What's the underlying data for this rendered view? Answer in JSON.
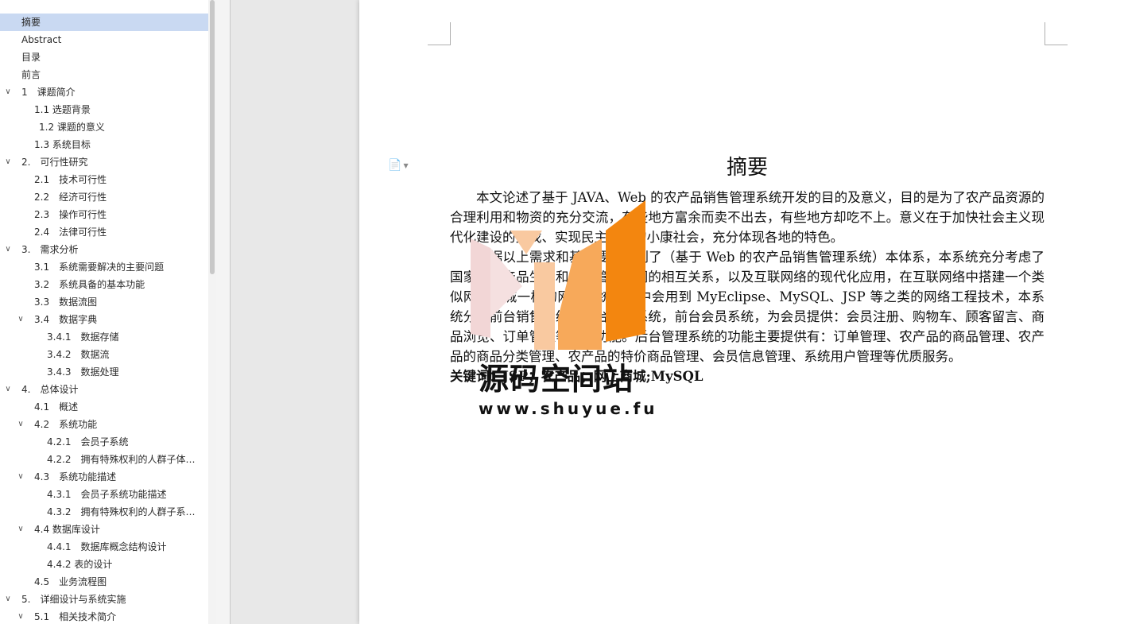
{
  "nav": {
    "items": [
      {
        "label": "摘要",
        "level": 0,
        "expandable": false,
        "selected": true
      },
      {
        "label": "Abstract",
        "level": 0,
        "expandable": false
      },
      {
        "label": "目录",
        "level": 0,
        "expandable": false
      },
      {
        "label": "前言",
        "level": 0,
        "expandable": false
      },
      {
        "label": "1　课题简介",
        "level": 0,
        "expandable": true
      },
      {
        "label": "1.1  选题背景",
        "level": 1,
        "expandable": false
      },
      {
        "label": "1.2  课题的意义",
        "level": 1,
        "expandable": false,
        "extra_indent": true
      },
      {
        "label": "1.3  系统目标",
        "level": 1,
        "expandable": false
      },
      {
        "label": "2.　可行性研究",
        "level": 0,
        "expandable": true
      },
      {
        "label": "2.1　技术可行性",
        "level": 1,
        "expandable": false
      },
      {
        "label": "2.2　经济可行性",
        "level": 1,
        "expandable": false
      },
      {
        "label": "2.3　操作可行性",
        "level": 1,
        "expandable": false
      },
      {
        "label": "2.4　法律可行性",
        "level": 1,
        "expandable": false
      },
      {
        "label": "3.　需求分析",
        "level": 0,
        "expandable": true
      },
      {
        "label": "3.1　系统需要解决的主要问题",
        "level": 1,
        "expandable": false
      },
      {
        "label": "3.2　系统具备的基本功能",
        "level": 1,
        "expandable": false
      },
      {
        "label": "3.3　数据流图",
        "level": 1,
        "expandable": false
      },
      {
        "label": "3.4　数据字典",
        "level": 1,
        "expandable": true
      },
      {
        "label": "3.4.1　数据存储",
        "level": 2,
        "expandable": false
      },
      {
        "label": "3.4.2　数据流",
        "level": 2,
        "expandable": false
      },
      {
        "label": "3.4.3　数据处理",
        "level": 2,
        "expandable": false
      },
      {
        "label": "4.　总体设计",
        "level": 0,
        "expandable": true
      },
      {
        "label": "4.1　概述",
        "level": 1,
        "expandable": false
      },
      {
        "label": "4.2　系统功能",
        "level": 1,
        "expandable": true
      },
      {
        "label": "4.2.1　会员子系统",
        "level": 2,
        "expandable": false
      },
      {
        "label": "4.2.2　拥有特殊权利的人群子体系 ...",
        "level": 2,
        "expandable": false
      },
      {
        "label": "4.3　系统功能描述",
        "level": 1,
        "expandable": true
      },
      {
        "label": "4.3.1　会员子系统功能描述",
        "level": 2,
        "expandable": false
      },
      {
        "label": "4.3.2　拥有特殊权利的人群子系统 ...",
        "level": 2,
        "expandable": false
      },
      {
        "label": "4.4  数据库设计",
        "level": 1,
        "expandable": true
      },
      {
        "label": "4.4.1　数据库概念结构设计",
        "level": 2,
        "expandable": false
      },
      {
        "label": "4.4.2 表的设计",
        "level": 2,
        "expandable": false
      },
      {
        "label": "4.5　业务流程图",
        "level": 1,
        "expandable": false
      },
      {
        "label": "5.　详细设计与系统实施",
        "level": 0,
        "expandable": true
      },
      {
        "label": "5.1　相关技术简介",
        "level": 1,
        "expandable": true
      }
    ]
  },
  "document": {
    "title": "摘要",
    "paragraphs": [
      "本文论述了基于 JAVA、Web 的农产品销售管理系统开发的目的及意义，目的是为了农产品资源的合理利用和物资的充分交流，有些地方富余而卖不出去，有些地方却吃不上。意义在于加快社会主义现代化建设的步伐、实现民主富强的小康社会，充分体现各地的特色。",
      "根据以上需求和基本要求规划了（基于 Web 的农产品销售管理系统）本体系，本系统充分考虑了国家的农产品生产和销售管理之间的相互关系，以及互联网络的现代化应用，在互联网络中搭建一个类似网上商城一样的网站系统，其中会用到 MyEclipse、MySQL、JSP 等之类的网络工程技术，本系统分为前台销售系统和后台管理系统，前台会员系统，为会员提供：会员注册、购物车、顾客留言、商品浏览、订单管理等主要功能。后台管理系统的功能主要提供有：订单管理、农产品的商品管理、农产品的商品分类管理、农产品的特价商品管理、会员信息管理、系统用户管理等优质服务。"
    ],
    "keywords": "关键词：JSP；农产品；网上商城;MySQL"
  },
  "watermark": {
    "text": "源码空间站",
    "url": "www.shuyue.fu",
    "colors": {
      "pink": "#f2d6d6",
      "peach": "#f9c9a0",
      "orange_light": "#f7a95a",
      "orange": "#f3860f"
    }
  },
  "colors": {
    "selected_bg": "#c9d9f2",
    "background": "#e8e8e8"
  }
}
